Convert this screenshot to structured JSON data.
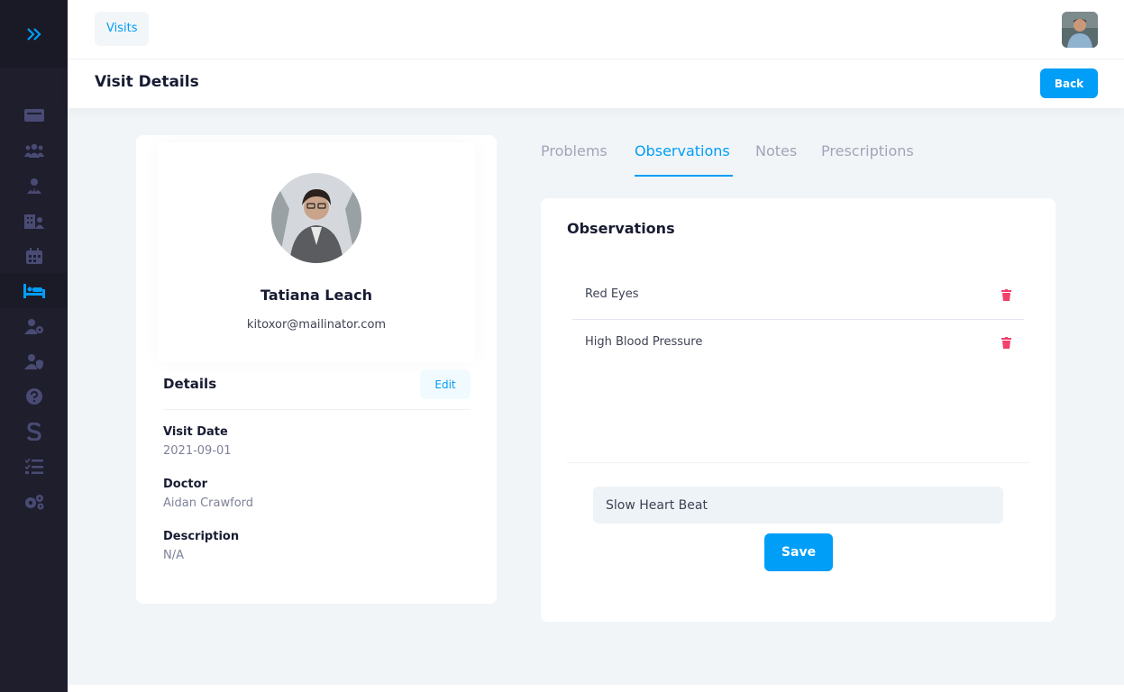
{
  "breadcrumb": {
    "label": "Visits"
  },
  "toolbar": {
    "title": "Visit Details",
    "back_label": "Back"
  },
  "sidebar": {
    "items": [
      {
        "icon": "dashboard-icon",
        "active": false
      },
      {
        "icon": "users-icon",
        "active": false
      },
      {
        "icon": "doctor-icon",
        "active": false
      },
      {
        "icon": "hospital-icon",
        "active": false
      },
      {
        "icon": "calendar-icon",
        "active": false
      },
      {
        "icon": "bed-icon",
        "active": true
      },
      {
        "icon": "user-settings-icon",
        "active": false
      },
      {
        "icon": "user-shield-icon",
        "active": false
      },
      {
        "icon": "help-icon",
        "active": false
      },
      {
        "icon": "subscription-icon",
        "active": false
      },
      {
        "icon": "tasks-icon",
        "active": false
      },
      {
        "icon": "settings-icon",
        "active": false
      }
    ]
  },
  "profile": {
    "name": "Tatiana Leach",
    "email": "kitoxor@mailinator.com"
  },
  "details": {
    "title": "Details",
    "edit_label": "Edit",
    "visit_date_label": "Visit Date",
    "visit_date": "2021-09-01",
    "doctor_label": "Doctor",
    "doctor": "Aidan Crawford",
    "description_label": "Description",
    "description": "N/A"
  },
  "tabs": [
    {
      "label": "Problems",
      "active": false
    },
    {
      "label": "Observations",
      "active": true
    },
    {
      "label": "Notes",
      "active": false
    },
    {
      "label": "Prescriptions",
      "active": false
    }
  ],
  "observations": {
    "title": "Observations",
    "items": [
      "Red Eyes",
      "High Blood Pressure"
    ],
    "input_value": "Slow Heart Beat",
    "save_label": "Save"
  },
  "colors": {
    "accent": "#009ef7",
    "sidebar": "#1e1e2d",
    "danger": "#f1416c"
  }
}
